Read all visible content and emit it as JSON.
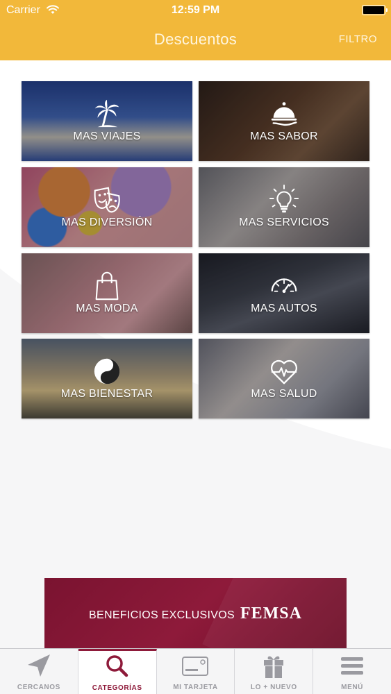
{
  "status_bar": {
    "carrier": "Carrier",
    "time": "12:59 PM"
  },
  "nav": {
    "title": "Descuentos",
    "filter_label": "FILTRO"
  },
  "categories": [
    {
      "label": "MAS VIAJES",
      "icon": "palm-tree-icon"
    },
    {
      "label": "MAS SABOR",
      "icon": "cloche-icon"
    },
    {
      "label": "MAS DIVERSIÓN",
      "icon": "theater-masks-icon"
    },
    {
      "label": "MAS SERVICIOS",
      "icon": "lightbulb-icon"
    },
    {
      "label": "MAS MODA",
      "icon": "shopping-bag-icon"
    },
    {
      "label": "MAS AUTOS",
      "icon": "speedometer-icon"
    },
    {
      "label": "MAS BIENESTAR",
      "icon": "yin-yang-icon"
    },
    {
      "label": "MAS SALUD",
      "icon": "heartbeat-icon"
    }
  ],
  "banner": {
    "text": "BENEFICIOS EXCLUSIVOS",
    "brand": "FEMSA"
  },
  "tabbar": {
    "tabs": [
      {
        "label": "CERCANOS",
        "icon": "location-arrow-icon",
        "active": false
      },
      {
        "label": "CATEGORÍAS",
        "icon": "search-icon",
        "active": true
      },
      {
        "label": "MI TARJETA",
        "icon": "card-icon",
        "active": false
      },
      {
        "label": "LO + NUEVO",
        "icon": "gift-icon",
        "active": false
      },
      {
        "label": "MENÚ",
        "icon": "hamburger-menu-icon",
        "active": false
      }
    ]
  },
  "colors": {
    "header": "#f2b83a",
    "accent": "#8e1a3a",
    "tab_inactive": "#9a9aa0"
  }
}
